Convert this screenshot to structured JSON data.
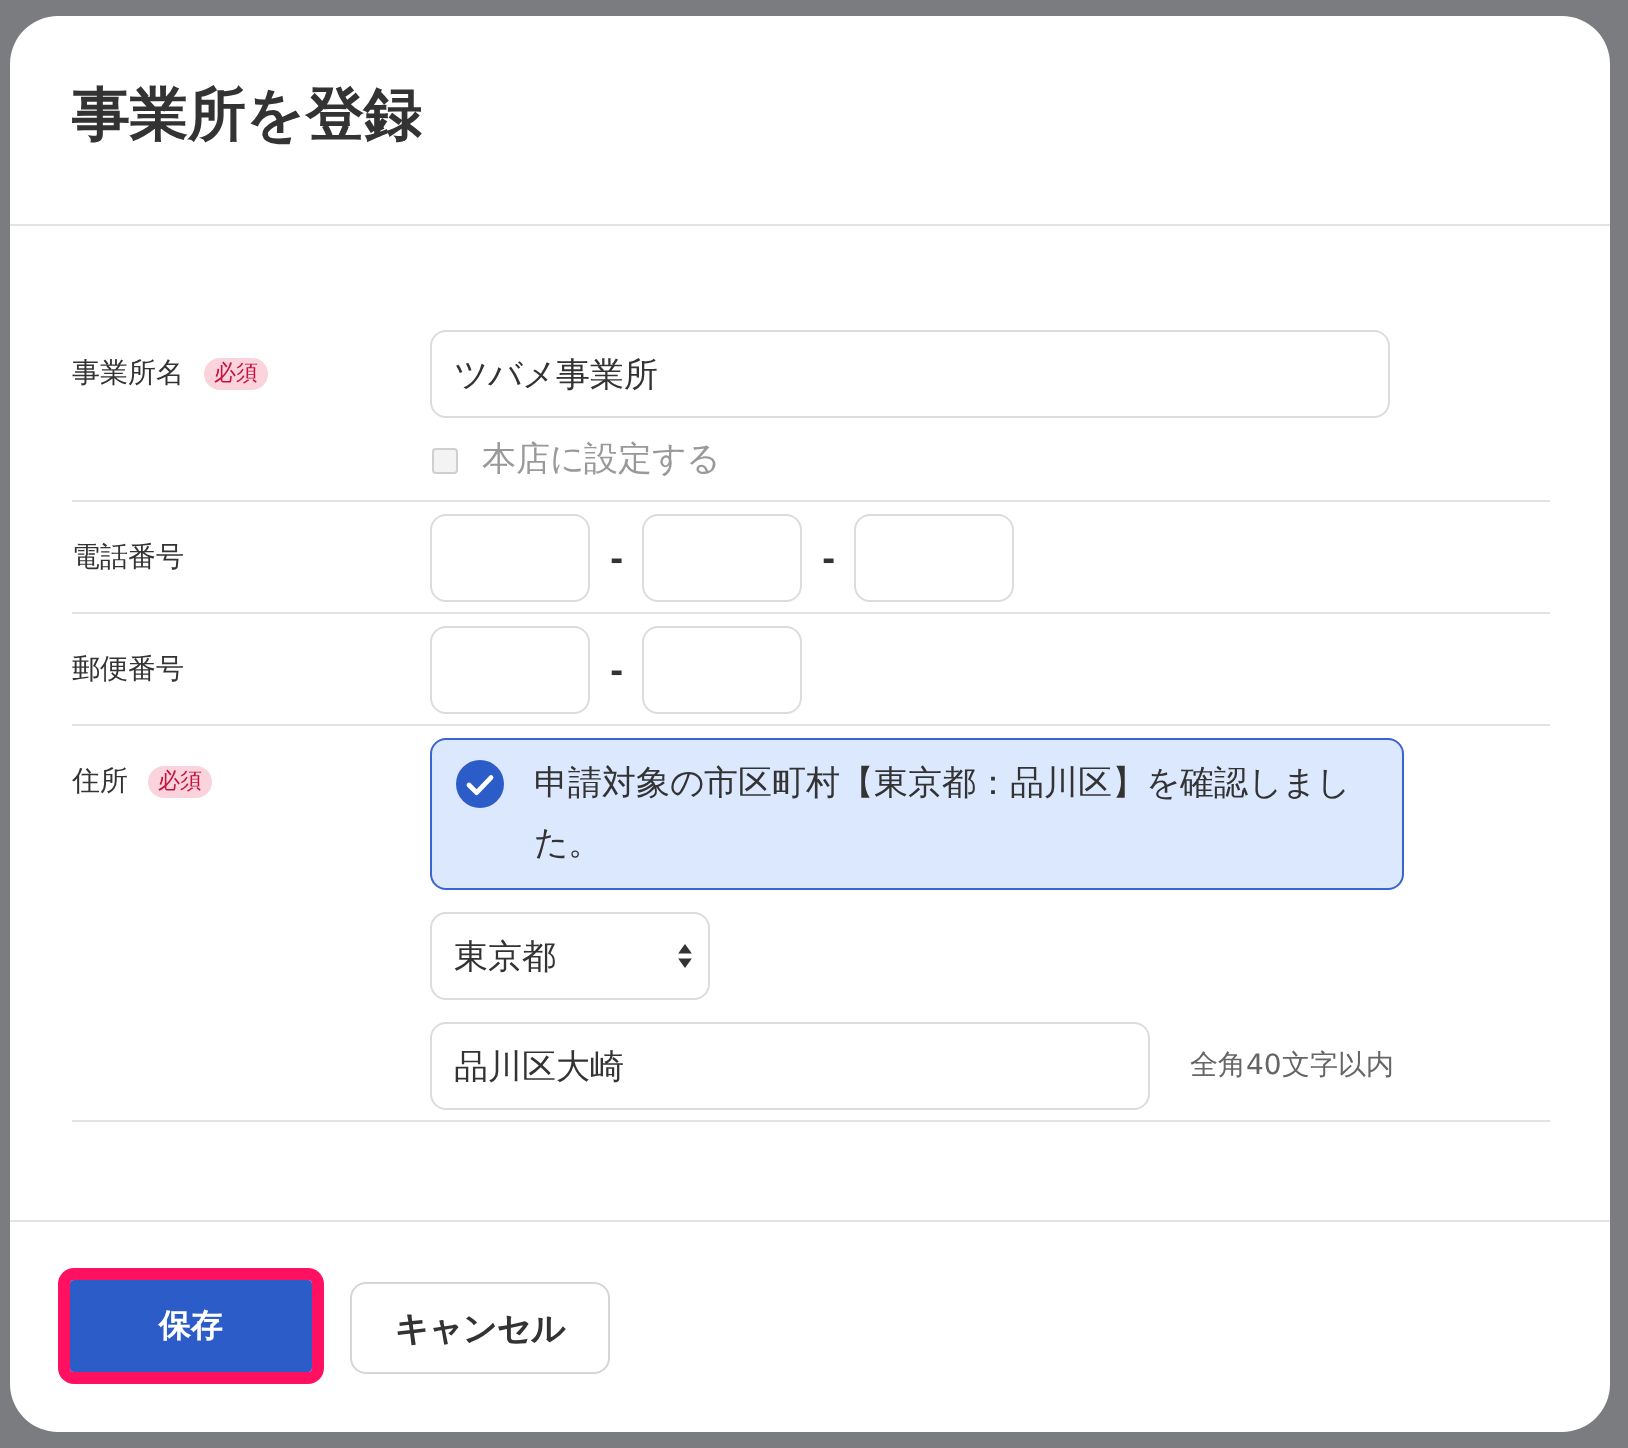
{
  "dialog": {
    "title": "事業所を登録"
  },
  "fields": [
    {
      "kind": "text",
      "label": "事業所名",
      "required": true,
      "required_badge": "必須",
      "value": "ツバメ事業所",
      "checkbox": {
        "label": "本店に設定する",
        "checked": false,
        "disabled": true
      }
    },
    {
      "kind": "split",
      "label": "電話番号",
      "required": false,
      "separators": [
        "-",
        "-"
      ]
    },
    {
      "kind": "split",
      "label": "郵便番号",
      "required": false,
      "separators": [
        "-"
      ]
    },
    {
      "kind": "address",
      "label": "住所",
      "required": true,
      "required_badge": "必須",
      "confirmation": {
        "text": "申請対象の市区町村【東京都：品川区】を確認しました。",
        "checked": true
      },
      "prefecture": "東京都",
      "street": "品川区大崎",
      "hint": "全角40文字以内"
    }
  ],
  "buttons": [
    {
      "kind": "primary",
      "label": "保存",
      "focused": true
    },
    {
      "kind": "secondary",
      "label": "キャンセル",
      "focused": false
    }
  ]
}
